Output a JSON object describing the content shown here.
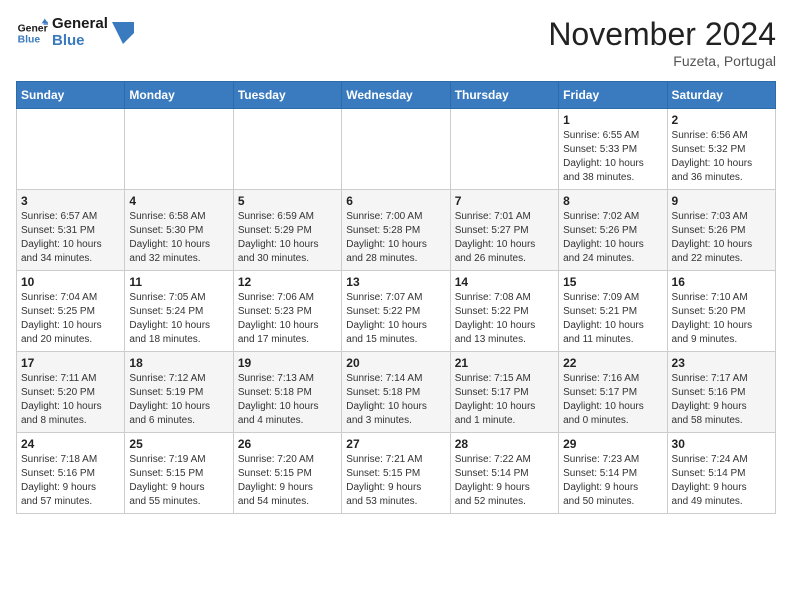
{
  "logo": {
    "line1": "General",
    "line2": "Blue"
  },
  "title": "November 2024",
  "location": "Fuzeta, Portugal",
  "days_of_week": [
    "Sunday",
    "Monday",
    "Tuesday",
    "Wednesday",
    "Thursday",
    "Friday",
    "Saturday"
  ],
  "weeks": [
    [
      {
        "day": "",
        "info": ""
      },
      {
        "day": "",
        "info": ""
      },
      {
        "day": "",
        "info": ""
      },
      {
        "day": "",
        "info": ""
      },
      {
        "day": "",
        "info": ""
      },
      {
        "day": "1",
        "info": "Sunrise: 6:55 AM\nSunset: 5:33 PM\nDaylight: 10 hours\nand 38 minutes."
      },
      {
        "day": "2",
        "info": "Sunrise: 6:56 AM\nSunset: 5:32 PM\nDaylight: 10 hours\nand 36 minutes."
      }
    ],
    [
      {
        "day": "3",
        "info": "Sunrise: 6:57 AM\nSunset: 5:31 PM\nDaylight: 10 hours\nand 34 minutes."
      },
      {
        "day": "4",
        "info": "Sunrise: 6:58 AM\nSunset: 5:30 PM\nDaylight: 10 hours\nand 32 minutes."
      },
      {
        "day": "5",
        "info": "Sunrise: 6:59 AM\nSunset: 5:29 PM\nDaylight: 10 hours\nand 30 minutes."
      },
      {
        "day": "6",
        "info": "Sunrise: 7:00 AM\nSunset: 5:28 PM\nDaylight: 10 hours\nand 28 minutes."
      },
      {
        "day": "7",
        "info": "Sunrise: 7:01 AM\nSunset: 5:27 PM\nDaylight: 10 hours\nand 26 minutes."
      },
      {
        "day": "8",
        "info": "Sunrise: 7:02 AM\nSunset: 5:26 PM\nDaylight: 10 hours\nand 24 minutes."
      },
      {
        "day": "9",
        "info": "Sunrise: 7:03 AM\nSunset: 5:26 PM\nDaylight: 10 hours\nand 22 minutes."
      }
    ],
    [
      {
        "day": "10",
        "info": "Sunrise: 7:04 AM\nSunset: 5:25 PM\nDaylight: 10 hours\nand 20 minutes."
      },
      {
        "day": "11",
        "info": "Sunrise: 7:05 AM\nSunset: 5:24 PM\nDaylight: 10 hours\nand 18 minutes."
      },
      {
        "day": "12",
        "info": "Sunrise: 7:06 AM\nSunset: 5:23 PM\nDaylight: 10 hours\nand 17 minutes."
      },
      {
        "day": "13",
        "info": "Sunrise: 7:07 AM\nSunset: 5:22 PM\nDaylight: 10 hours\nand 15 minutes."
      },
      {
        "day": "14",
        "info": "Sunrise: 7:08 AM\nSunset: 5:22 PM\nDaylight: 10 hours\nand 13 minutes."
      },
      {
        "day": "15",
        "info": "Sunrise: 7:09 AM\nSunset: 5:21 PM\nDaylight: 10 hours\nand 11 minutes."
      },
      {
        "day": "16",
        "info": "Sunrise: 7:10 AM\nSunset: 5:20 PM\nDaylight: 10 hours\nand 9 minutes."
      }
    ],
    [
      {
        "day": "17",
        "info": "Sunrise: 7:11 AM\nSunset: 5:20 PM\nDaylight: 10 hours\nand 8 minutes."
      },
      {
        "day": "18",
        "info": "Sunrise: 7:12 AM\nSunset: 5:19 PM\nDaylight: 10 hours\nand 6 minutes."
      },
      {
        "day": "19",
        "info": "Sunrise: 7:13 AM\nSunset: 5:18 PM\nDaylight: 10 hours\nand 4 minutes."
      },
      {
        "day": "20",
        "info": "Sunrise: 7:14 AM\nSunset: 5:18 PM\nDaylight: 10 hours\nand 3 minutes."
      },
      {
        "day": "21",
        "info": "Sunrise: 7:15 AM\nSunset: 5:17 PM\nDaylight: 10 hours\nand 1 minute."
      },
      {
        "day": "22",
        "info": "Sunrise: 7:16 AM\nSunset: 5:17 PM\nDaylight: 10 hours\nand 0 minutes."
      },
      {
        "day": "23",
        "info": "Sunrise: 7:17 AM\nSunset: 5:16 PM\nDaylight: 9 hours\nand 58 minutes."
      }
    ],
    [
      {
        "day": "24",
        "info": "Sunrise: 7:18 AM\nSunset: 5:16 PM\nDaylight: 9 hours\nand 57 minutes."
      },
      {
        "day": "25",
        "info": "Sunrise: 7:19 AM\nSunset: 5:15 PM\nDaylight: 9 hours\nand 55 minutes."
      },
      {
        "day": "26",
        "info": "Sunrise: 7:20 AM\nSunset: 5:15 PM\nDaylight: 9 hours\nand 54 minutes."
      },
      {
        "day": "27",
        "info": "Sunrise: 7:21 AM\nSunset: 5:15 PM\nDaylight: 9 hours\nand 53 minutes."
      },
      {
        "day": "28",
        "info": "Sunrise: 7:22 AM\nSunset: 5:14 PM\nDaylight: 9 hours\nand 52 minutes."
      },
      {
        "day": "29",
        "info": "Sunrise: 7:23 AM\nSunset: 5:14 PM\nDaylight: 9 hours\nand 50 minutes."
      },
      {
        "day": "30",
        "info": "Sunrise: 7:24 AM\nSunset: 5:14 PM\nDaylight: 9 hours\nand 49 minutes."
      }
    ]
  ]
}
